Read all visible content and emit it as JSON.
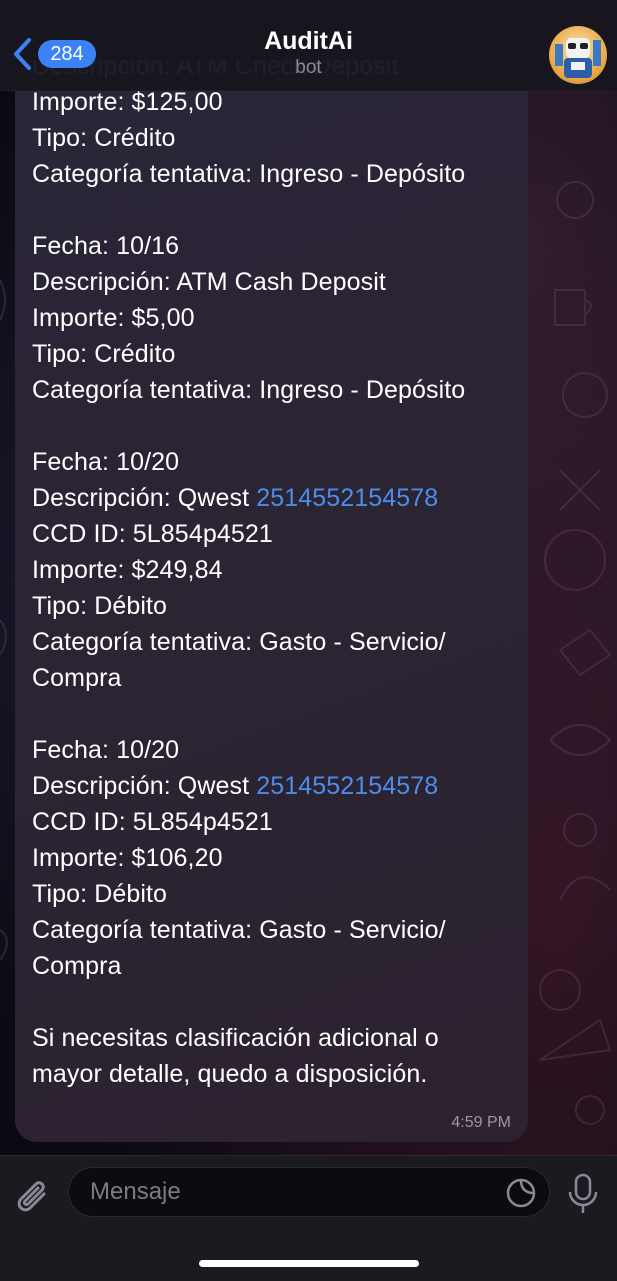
{
  "header": {
    "back_count": "284",
    "title": "AuditAi",
    "subtitle": "bot"
  },
  "message": {
    "lines": [
      {
        "text": "Descripción: ATM Check Deposit"
      },
      {
        "text": "Importe: $125,00"
      },
      {
        "text": "Tipo: Crédito"
      },
      {
        "text": "Categoría tentativa: Ingreso - Depósito"
      },
      {
        "text": ""
      },
      {
        "text": "Fecha: 10/16"
      },
      {
        "text": "Descripción: ATM Cash Deposit"
      },
      {
        "text": "Importe: $5,00"
      },
      {
        "text": "Tipo: Crédito"
      },
      {
        "text": "Categoría tentativa: Ingreso - Depósito"
      },
      {
        "text": ""
      },
      {
        "text": "Fecha: 10/20"
      },
      {
        "text": "Descripción: Qwest ",
        "link": "2514552154578"
      },
      {
        "text": "CCD ID: 5L854p4521"
      },
      {
        "text": "Importe: $249,84"
      },
      {
        "text": "Tipo: Débito"
      },
      {
        "text": "Categoría tentativa: Gasto - Servicio/"
      },
      {
        "text": "Compra"
      },
      {
        "text": ""
      },
      {
        "text": "Fecha: 10/20"
      },
      {
        "text": "Descripción: Qwest ",
        "link": "2514552154578"
      },
      {
        "text": "CCD ID: 5L854p4521"
      },
      {
        "text": "Importe: $106,20"
      },
      {
        "text": "Tipo: Débito"
      },
      {
        "text": "Categoría tentativa: Gasto - Servicio/"
      },
      {
        "text": "Compra"
      },
      {
        "text": ""
      },
      {
        "text": "Si necesitas clasificación adicional o"
      },
      {
        "text": "mayor detalle, quedo a disposición."
      }
    ],
    "time": "4:59 PM"
  },
  "composer": {
    "placeholder": "Mensaje"
  },
  "icons": [
    "chevron-left-icon",
    "paperclip-icon",
    "sticker-icon",
    "microphone-icon"
  ],
  "colors": {
    "accent": "#3b82f6",
    "link": "#4c8dea",
    "bubble": "#2b2433"
  }
}
